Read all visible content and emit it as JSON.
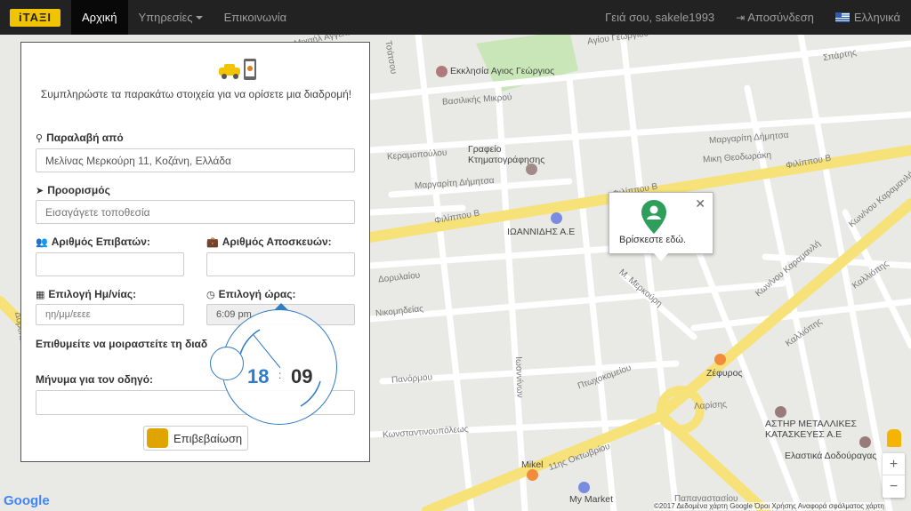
{
  "navbar": {
    "brand": "iΤΑΞΙ",
    "home": "Αρχική",
    "services": "Υπηρεσίες",
    "contact": "Επικοινωνία",
    "greeting": "Γειά σου, sakele1993",
    "logout": "Αποσύνδεση",
    "language": "Ελληνικά"
  },
  "form": {
    "intro": "Συμπληρώστε τα παρακάτω στοιχεία για να ορίσετε μια διαδρομή!",
    "pickup_label": "Παραλαβή από",
    "pickup_value": "Μελίνας Μερκούρη 11, Κοζάνη, Ελλάδα",
    "destination_label": "Προορισμός",
    "destination_placeholder": "Εισαγάγετε τοποθεσία",
    "passengers_label": "Αριθμός Επιβατών:",
    "luggage_label": "Αριθμός Αποσκευών:",
    "date_label": "Επιλογή Ημ/νίας:",
    "date_placeholder": "ηη/μμ/εεεε",
    "time_label": "Επιλογή ώρας:",
    "time_value": "6:09 pm",
    "share_label": "Επιθυμείτε να μοιραστείτε τη διαδ",
    "message_label": "Μήνυμα για τον οδηγό:",
    "confirm": "Επιβεβαίωση"
  },
  "clock": {
    "hours": "18",
    "separator": ":",
    "minutes": "09"
  },
  "bubble": {
    "text": "Βρίσκεστε εδώ."
  },
  "map": {
    "streets": [
      {
        "text": "Μιχαήλ Αγγελου"
      },
      {
        "text": "Αγίου Γεωργίου"
      },
      {
        "text": "Σπάρτης"
      },
      {
        "text": "Τσάτσου"
      },
      {
        "text": "Βασιλικής Μικρού"
      },
      {
        "text": "Κεραμοπούλου"
      },
      {
        "text": "Μαργαρίτη Δήμητσα"
      },
      {
        "text": "Μαργαρίτη Δήμητσα"
      },
      {
        "text": "Μικη Θεοδωράκη"
      },
      {
        "text": "Φιλίππου Β"
      },
      {
        "text": "Φιλίππου Β"
      },
      {
        "text": "Φιλίππου Β"
      },
      {
        "text": "Κων/νου Καραμανλή"
      },
      {
        "text": "Κων/νου Καραμανλή"
      },
      {
        "text": "Μ. Μερκούρη"
      },
      {
        "text": "Δορυλαίου"
      },
      {
        "text": "Νικομηδείας"
      },
      {
        "text": "Καλλιόπης"
      },
      {
        "text": "Καλλιόπης"
      },
      {
        "text": "Πτωχοκομείου"
      },
      {
        "text": "Πανόρμου"
      },
      {
        "text": "Λαρίσης"
      },
      {
        "text": "Κωνσταντινουπόλεως"
      },
      {
        "text": "11ης Οκτωβρίου"
      },
      {
        "text": "Δορυλαίου"
      },
      {
        "text": "Ιωαννίνων"
      },
      {
        "text": "Παπαναστασίου"
      }
    ],
    "pois": [
      {
        "text": "Εκκλησία Αγιος Γεώργιος"
      },
      {
        "text": "Γραφείο Κτηματογράφησης"
      },
      {
        "text": "ΙΩΑΝΝΙΔΗΣ Α.Ε"
      },
      {
        "text": "Ζέφυρος"
      },
      {
        "text": "ΑΣΤΗΡ ΜΕΤΑΛΛΙΚΕΣ ΚΑΤΑΣΚΕΥΕΣ Α.Ε"
      },
      {
        "text": "Ελαστικά Δοδούραγας"
      },
      {
        "text": "Mikel"
      },
      {
        "text": "My Market"
      }
    ],
    "footer": "©2017 Δεδομένα χάρτη Google    Όροι Χρήσης    Αναφορά σφάλματος χάρτη",
    "google": "Google"
  },
  "colors": {
    "brand": "#f2c300",
    "accent": "#2f7bc4",
    "pin": "#2e9e5b"
  }
}
